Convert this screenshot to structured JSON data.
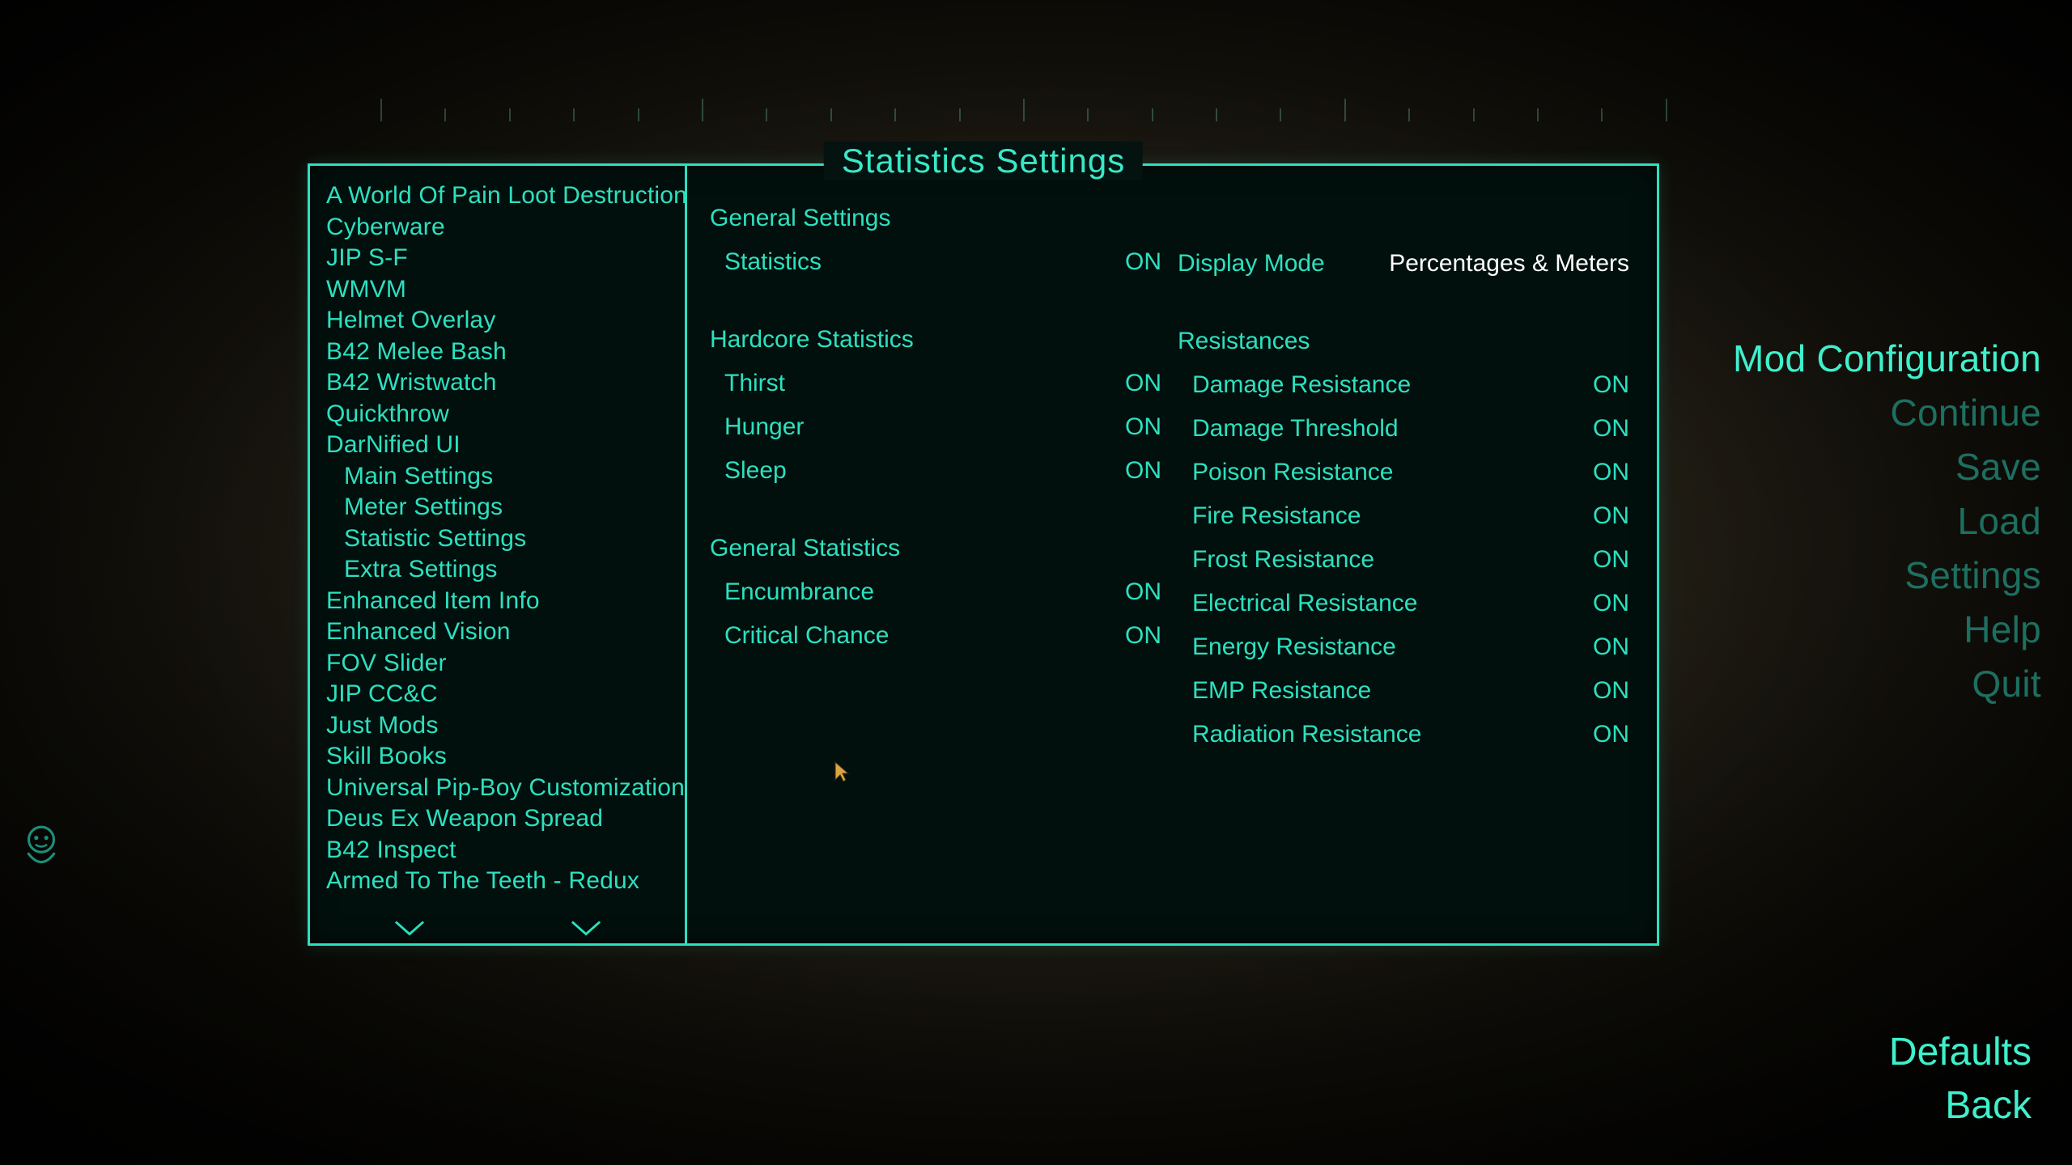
{
  "title": "Statistics Settings",
  "sidebar": {
    "items": [
      {
        "label": "A World Of Pain Loot Destruction",
        "indent": 0
      },
      {
        "label": "Cyberware",
        "indent": 0
      },
      {
        "label": "JIP S-F",
        "indent": 0
      },
      {
        "label": "WMVM",
        "indent": 0
      },
      {
        "label": "Helmet Overlay",
        "indent": 0
      },
      {
        "label": "B42 Melee Bash",
        "indent": 0
      },
      {
        "label": "B42 Wristwatch",
        "indent": 0
      },
      {
        "label": "Quickthrow",
        "indent": 0
      },
      {
        "label": "DarNified UI",
        "indent": 0
      },
      {
        "label": "Main Settings",
        "indent": 1
      },
      {
        "label": "Meter Settings",
        "indent": 1
      },
      {
        "label": "Statistic Settings",
        "indent": 1
      },
      {
        "label": "Extra Settings",
        "indent": 1
      },
      {
        "label": "Enhanced Item Info",
        "indent": 0
      },
      {
        "label": "Enhanced Vision",
        "indent": 0
      },
      {
        "label": "FOV Slider",
        "indent": 0
      },
      {
        "label": "JIP CC&C",
        "indent": 0
      },
      {
        "label": "Just Mods",
        "indent": 0
      },
      {
        "label": "Skill Books",
        "indent": 0
      },
      {
        "label": "Universal Pip-Boy Customization",
        "indent": 0
      },
      {
        "label": "Deus Ex Weapon Spread",
        "indent": 0
      },
      {
        "label": "B42 Inspect",
        "indent": 0
      },
      {
        "label": "Armed To The Teeth - Redux",
        "indent": 0
      }
    ]
  },
  "general": {
    "title": "General Settings",
    "statistics_label": "Statistics",
    "statistics_value": "ON",
    "display_mode_label": "Display Mode",
    "display_mode_value": "Percentages & Meters"
  },
  "hardcore": {
    "title": "Hardcore Statistics",
    "thirst_label": "Thirst",
    "thirst_value": "ON",
    "hunger_label": "Hunger",
    "hunger_value": "ON",
    "sleep_label": "Sleep",
    "sleep_value": "ON"
  },
  "genstats": {
    "title": "General Statistics",
    "enc_label": "Encumbrance",
    "enc_value": "ON",
    "crit_label": "Critical Chance",
    "crit_value": "ON"
  },
  "resist": {
    "title": "Resistances",
    "dr_label": "Damage Resistance",
    "dr_value": "ON",
    "dt_label": "Damage Threshold",
    "dt_value": "ON",
    "poison_label": "Poison Resistance",
    "poison_value": "ON",
    "fire_label": "Fire Resistance",
    "fire_value": "ON",
    "frost_label": "Frost Resistance",
    "frost_value": "ON",
    "elec_label": "Electrical Resistance",
    "elec_value": "ON",
    "energy_label": "Energy Resistance",
    "energy_value": "ON",
    "emp_label": "EMP Resistance",
    "emp_value": "ON",
    "rad_label": "Radiation Resistance",
    "rad_value": "ON"
  },
  "rightmenu": {
    "modconfig": "Mod Configuration",
    "continue": "Continue",
    "save": "Save",
    "load": "Load",
    "settings": "Settings",
    "help": "Help",
    "quit": "Quit"
  },
  "bottom": {
    "defaults": "Defaults",
    "back": "Back"
  }
}
